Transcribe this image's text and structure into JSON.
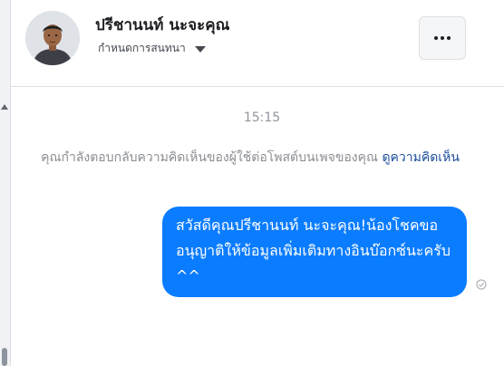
{
  "conversation": {
    "contact_name": "ปรีชานนท์ นะจะคุณ",
    "settings_label": "กำหนดการสนทนา",
    "more_options_icon": "more-horizontal-icon",
    "settings_caret_icon": "caret-down-icon"
  },
  "thread": {
    "timestamp": "15:15",
    "notice_text": "คุณกำลังตอบกลับความคิดเห็นของผู้ใช้ต่อโพสต์บนเพจของคุณ",
    "notice_link": "ดูความคิดเห็น",
    "messages": [
      {
        "text": "สวัสดีคุณปรีชานนท์ นะจะคุณ!น้องโชคขออนุญาติให้ข้อมูลเพิ่มเติมทางอินบ๊อกซ์นะครับ ^^",
        "status_icon": "seen-check-icon"
      }
    ]
  },
  "colors": {
    "bubble": "#0a7cff",
    "link": "#1c4e9b",
    "muted_text": "#8a8d91"
  }
}
